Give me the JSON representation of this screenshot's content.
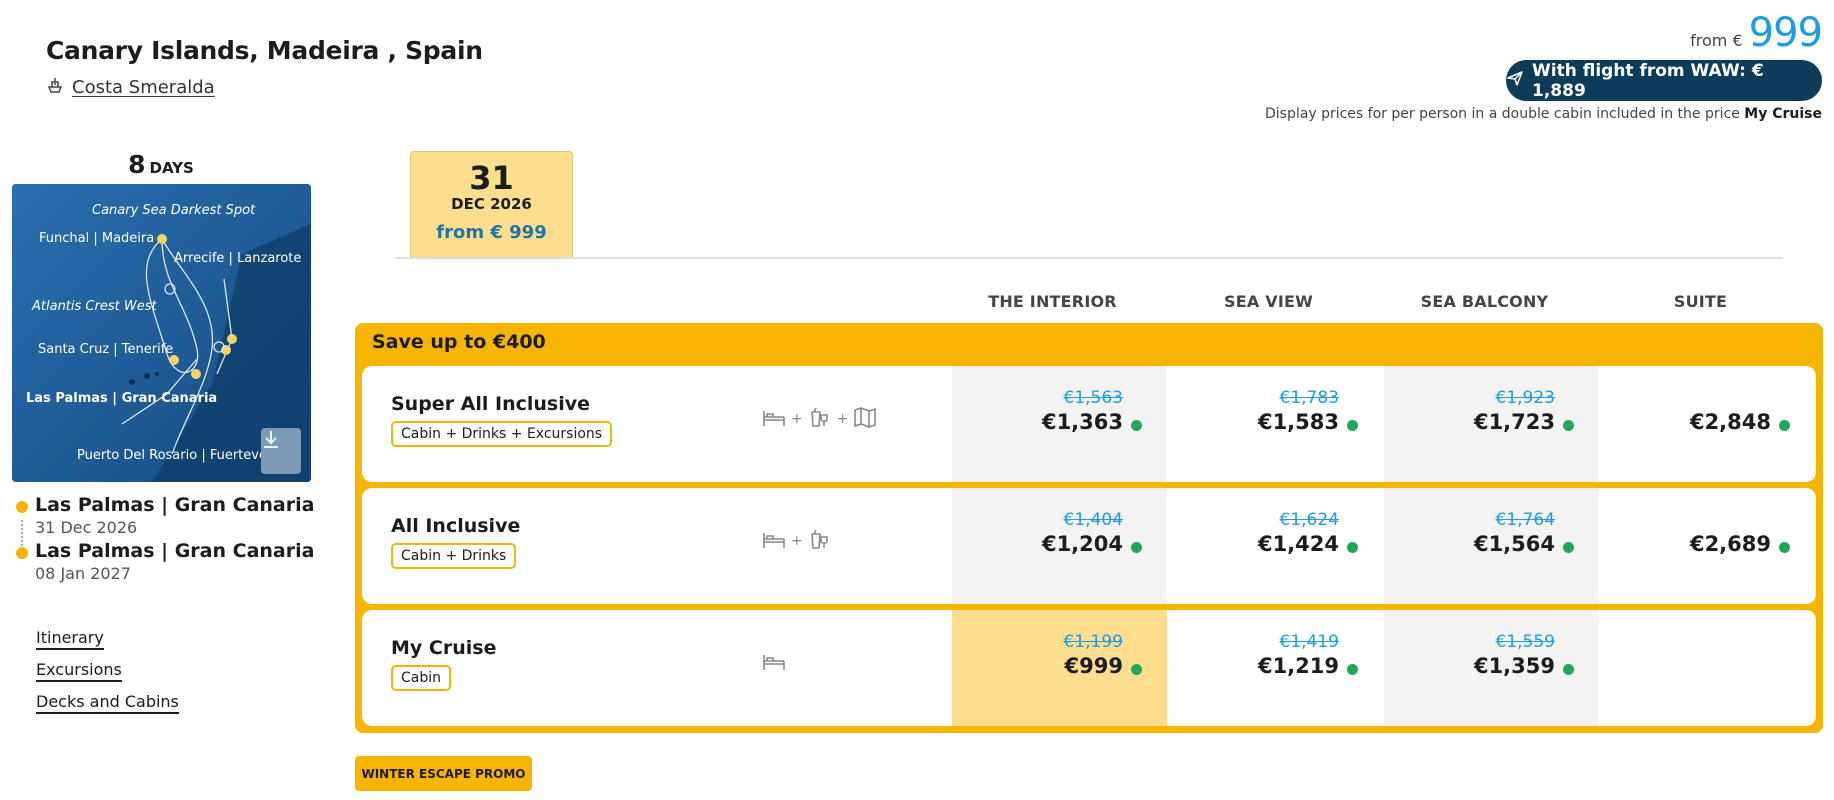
{
  "header": {
    "title": "Canary Islands, Madeira , Spain",
    "ship_name": "Costa Smeralda",
    "from_label": "from €",
    "from_value": "999",
    "flight_button": "With flight from WAW: € 1,889",
    "price_note_prefix": "Display prices for per person in a double cabin included in the price",
    "price_note_bold": "My Cruise"
  },
  "trip": {
    "days_number": "8",
    "days_unit": "DAYS",
    "map_labels": {
      "canary_sea": "Canary Sea Darkest Spot",
      "funchal": "Funchal | Madeira",
      "arrecife": "Arrecife | Lanzarote",
      "atlantis": "Atlantis Crest West",
      "santa_cruz": "Santa Cruz | Tenerife",
      "las_palmas": "Las Palmas | Gran Canaria",
      "puerto": "Puerto Del Rosario | Fuerteventura"
    },
    "start_port": "Las Palmas | Gran Canaria",
    "start_date": "31 Dec 2026",
    "end_port": "Las Palmas | Gran Canaria",
    "end_date": "08 Jan 2027"
  },
  "links": {
    "itinerary": "Itinerary",
    "excursions": "Excursions",
    "decks": "Decks and Cabins"
  },
  "date_tab": {
    "day": "31",
    "month_year": "DEC 2026",
    "price": "from € 999"
  },
  "columns": [
    "THE INTERIOR",
    "SEA VIEW",
    "SEA BALCONY",
    "SUITE"
  ],
  "promo": {
    "title": "Save up to €400",
    "tag": "WINTER ESCAPE PROMO"
  },
  "packages": [
    {
      "name": "Super All Inclusive",
      "badge": "Cabin + Drinks + Excursions",
      "plus": "+",
      "prices": [
        {
          "old": "€1,563",
          "new": "€1,363"
        },
        {
          "old": "€1,783",
          "new": "€1,583"
        },
        {
          "old": "€1,923",
          "new": "€1,723"
        },
        {
          "old": "",
          "new": "€2,848"
        }
      ]
    },
    {
      "name": "All Inclusive",
      "badge": "Cabin + Drinks",
      "plus": "+",
      "prices": [
        {
          "old": "€1,404",
          "new": "€1,204"
        },
        {
          "old": "€1,624",
          "new": "€1,424"
        },
        {
          "old": "€1,764",
          "new": "€1,564"
        },
        {
          "old": "",
          "new": "€2,689"
        }
      ]
    },
    {
      "name": "My Cruise",
      "badge": "Cabin",
      "plus": "",
      "prices": [
        {
          "old": "€1,199",
          "new": "€999"
        },
        {
          "old": "€1,419",
          "new": "€1,219"
        },
        {
          "old": "€1,559",
          "new": "€1,359"
        }
      ]
    }
  ],
  "colors": {
    "accent_yellow": "#f7b500",
    "highlight_yellow": "#fddd8e",
    "link_blue": "#1f9be6",
    "navy": "#0d3b5a",
    "available_green": "#1fa85a"
  }
}
